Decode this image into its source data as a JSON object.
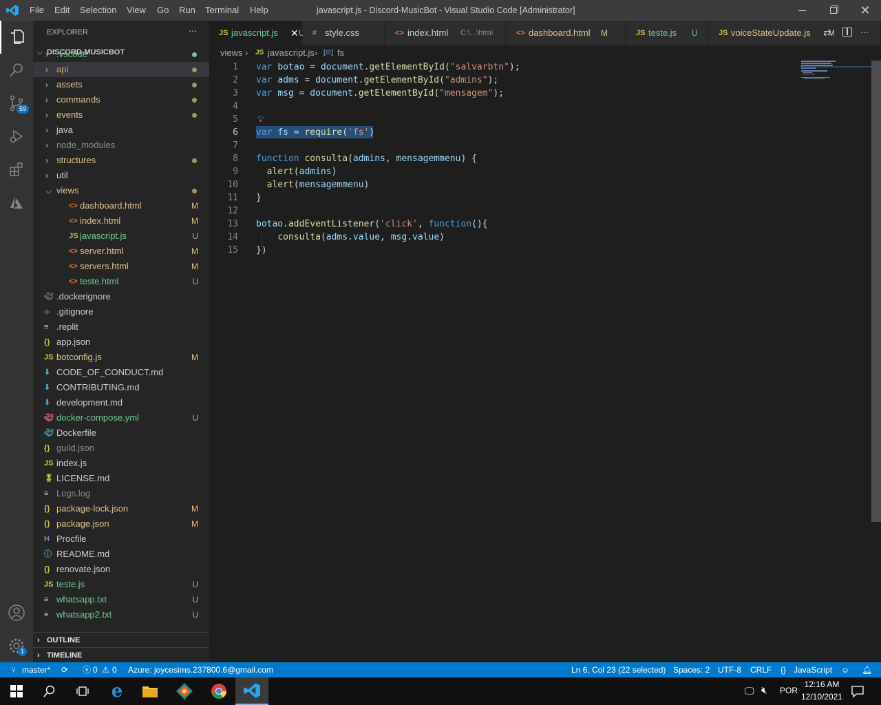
{
  "window": {
    "title": "javascript.js - Discord-MusicBot - Visual Studio Code [Administrator]"
  },
  "menu": [
    "File",
    "Edit",
    "Selection",
    "View",
    "Go",
    "Run",
    "Terminal",
    "Help"
  ],
  "activity": {
    "scm_badge": "59",
    "settings_badge": "1"
  },
  "explorer": {
    "header": "EXPLORER",
    "more": "···",
    "root": "DISCORD-MUSICBOT",
    "items": [
      {
        "label": ".vscode",
        "type": "folder",
        "color": "#73c991",
        "status": "dot",
        "dot_color": "#73c991"
      },
      {
        "label": "api",
        "type": "folder",
        "color": "#c5a56a",
        "status": "dot",
        "dot_color": "#a5926a"
      },
      {
        "label": "assets",
        "type": "folder",
        "color": "#e2c08d",
        "status": "dot",
        "dot_color": "#a5926a"
      },
      {
        "label": "commands",
        "type": "folder",
        "color": "#e2c08d",
        "status": "dot",
        "dot_color": "#a5926a"
      },
      {
        "label": "events",
        "type": "folder",
        "color": "#e2c08d",
        "status": "dot",
        "dot_color": "#a5926a"
      },
      {
        "label": "java",
        "type": "folder",
        "color": "#cccccc"
      },
      {
        "label": "node_modules",
        "type": "folder",
        "color": "#8c8c8c"
      },
      {
        "label": "structures",
        "type": "folder",
        "color": "#e2c08d",
        "status": "dot",
        "dot_color": "#a5926a"
      },
      {
        "label": "util",
        "type": "folder",
        "color": "#cccccc"
      },
      {
        "label": "views",
        "type": "folder-open",
        "color": "#e2c08d",
        "status": "dot",
        "dot_color": "#a5926a"
      },
      {
        "label": "dashboard.html",
        "type": "html",
        "color": "#e2c08d",
        "status": "M",
        "indent": 1
      },
      {
        "label": "index.html",
        "type": "html",
        "color": "#e2c08d",
        "status": "M",
        "indent": 1
      },
      {
        "label": "javascript.js",
        "type": "js",
        "color": "#73c991",
        "status": "U",
        "indent": 1
      },
      {
        "label": "server.html",
        "type": "html",
        "color": "#e2c08d",
        "status": "M",
        "indent": 1
      },
      {
        "label": "servers.html",
        "type": "html",
        "color": "#e2c08d",
        "status": "M",
        "indent": 1
      },
      {
        "label": "teste.html",
        "type": "html",
        "color": "#73c991",
        "status": "U",
        "indent": 1
      },
      {
        "label": ".dockerignore",
        "type": "docker-dim",
        "color": "#cccccc"
      },
      {
        "label": ".gitignore",
        "type": "git",
        "color": "#cccccc"
      },
      {
        "label": ".replit",
        "type": "text",
        "color": "#cccccc"
      },
      {
        "label": "app.json",
        "type": "json",
        "color": "#cccccc"
      },
      {
        "label": "botconfig.js",
        "type": "js",
        "color": "#e2c08d",
        "status": "M"
      },
      {
        "label": "CODE_OF_CONDUCT.md",
        "type": "md",
        "color": "#cccccc"
      },
      {
        "label": "CONTRIBUTING.md",
        "type": "md",
        "color": "#cccccc"
      },
      {
        "label": "development.md",
        "type": "md",
        "color": "#cccccc"
      },
      {
        "label": "docker-compose.yml",
        "type": "yml",
        "color": "#73c991",
        "status": "U"
      },
      {
        "label": "Dockerfile",
        "type": "docker",
        "color": "#cccccc"
      },
      {
        "label": "guild.json",
        "type": "json",
        "color": "#8c8c8c"
      },
      {
        "label": "index.js",
        "type": "js",
        "color": "#cccccc"
      },
      {
        "label": "LICENSE.md",
        "type": "license",
        "color": "#cccccc"
      },
      {
        "label": "Logs.log",
        "type": "text",
        "color": "#8c8c8c"
      },
      {
        "label": "package-lock.json",
        "type": "json",
        "color": "#e2c08d",
        "status": "M"
      },
      {
        "label": "package.json",
        "type": "json",
        "color": "#e2c08d",
        "status": "M"
      },
      {
        "label": "Procfile",
        "type": "heroku",
        "color": "#cccccc"
      },
      {
        "label": "README.md",
        "type": "info",
        "color": "#cccccc"
      },
      {
        "label": "renovate.json",
        "type": "json",
        "color": "#cccccc"
      },
      {
        "label": "teste.js",
        "type": "js",
        "color": "#73c991",
        "status": "U"
      },
      {
        "label": "whatsapp.txt",
        "type": "text",
        "color": "#73c991",
        "status": "U"
      },
      {
        "label": "whatsapp2.txt",
        "type": "text",
        "color": "#73c991",
        "status": "U"
      }
    ],
    "outline": "OUTLINE",
    "timeline": "TIMELINE"
  },
  "tabs": [
    {
      "label": "javascript.js",
      "icon": "JS",
      "icon_color": "#cbcb41",
      "label_color": "#73c991",
      "status": "U",
      "active": true
    },
    {
      "label": "style.css",
      "icon": "#",
      "icon_color": "#519aba",
      "label_color": "#cccccc",
      "status": ""
    },
    {
      "label": "index.html",
      "icon": "<>",
      "icon_color": "#e37933",
      "label_color": "#cccccc",
      "status": "",
      "desc": "C:\\...\\html"
    },
    {
      "label": "dashboard.html",
      "icon": "<>",
      "icon_color": "#e37933",
      "label_color": "#e2c08d",
      "status": "M"
    },
    {
      "label": "teste.js",
      "icon": "JS",
      "icon_color": "#cbcb41",
      "label_color": "#73c991",
      "status": "U"
    },
    {
      "label": "voiceStateUpdate.js",
      "icon": "JS",
      "icon_color": "#cbcb41",
      "label_color": "#e2c08d",
      "status": "M"
    }
  ],
  "breadcrumb": {
    "folder": "views",
    "file": "javascript.js",
    "symbol": "fs"
  },
  "editor": {
    "line_numbers": [
      "1",
      "2",
      "3",
      "4",
      "5",
      "6",
      "7",
      "8",
      "9",
      "10",
      "11",
      "12",
      "13",
      "14",
      "15"
    ]
  },
  "status": {
    "branch": "master*",
    "errors": "0",
    "warnings": "0",
    "azure": "Azure: joycesims.237800.6@gmail.com",
    "position": "Ln 6, Col 23 (22 selected)",
    "spaces": "Spaces: 2",
    "encoding": "UTF-8",
    "eol": "CRLF",
    "language": "JavaScript"
  },
  "taskbar": {
    "lang": "POR",
    "time": "12:16 AM",
    "date": "12/10/2021"
  }
}
